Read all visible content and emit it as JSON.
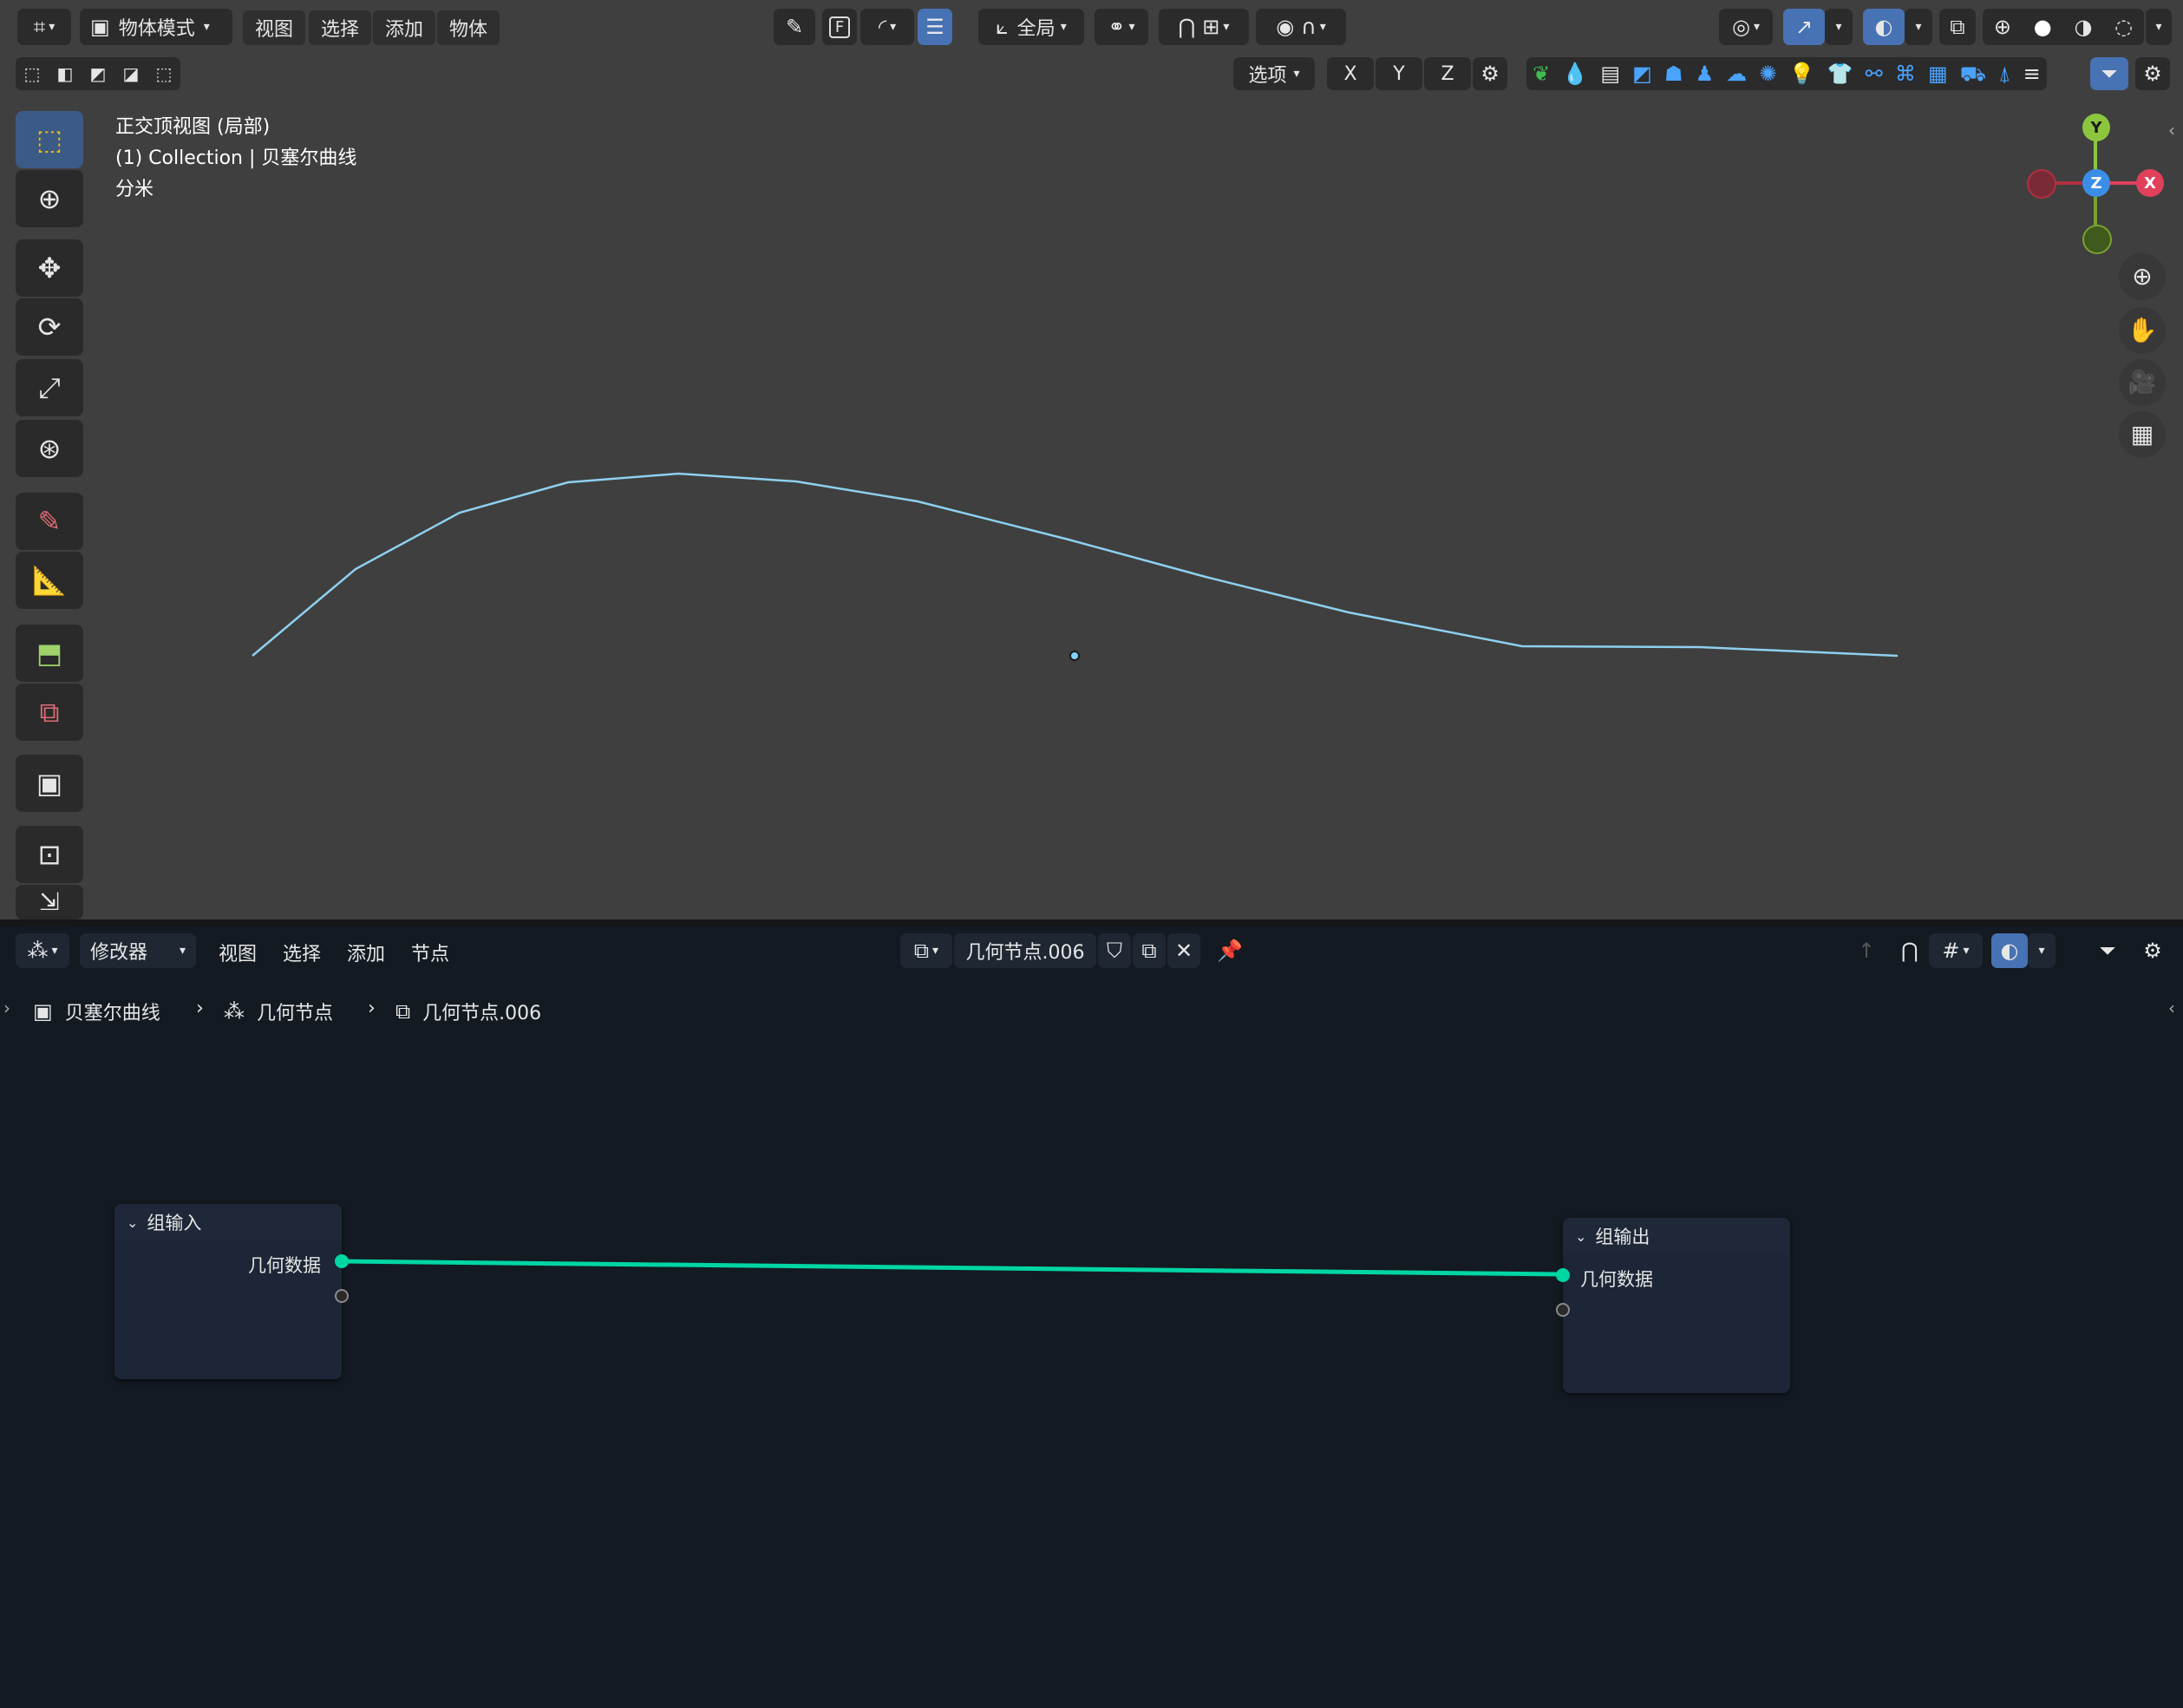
{
  "viewport": {
    "header": {
      "mode_label": "物体模式",
      "menu": [
        "视图",
        "选择",
        "添加",
        "物体"
      ],
      "orientation_label": "全局",
      "options_label": "选项",
      "axes": [
        "X",
        "Y",
        "Z"
      ],
      "f_key": "F"
    },
    "overlay": {
      "view_name": "正交顶视图 (局部)",
      "collection": "(1) Collection | 贝塞尔曲线",
      "unit": "分米"
    },
    "gizmo": {
      "x": "X",
      "y": "Y",
      "z": "Z"
    },
    "curve_color": "#8ed0ef"
  },
  "node_editor": {
    "header": {
      "type_label": "修改器",
      "menu": [
        "视图",
        "选择",
        "添加",
        "节点"
      ],
      "node_group_name": "几何节点.006"
    },
    "breadcrumb": {
      "object": "贝塞尔曲线",
      "modifier": "几何节点",
      "node_group": "几何节点.006"
    },
    "nodes": {
      "group_input": {
        "title": "组输入",
        "socket": "几何数据"
      },
      "group_output": {
        "title": "组输出",
        "socket": "几何数据"
      }
    },
    "link_color": "#00d6a3"
  }
}
